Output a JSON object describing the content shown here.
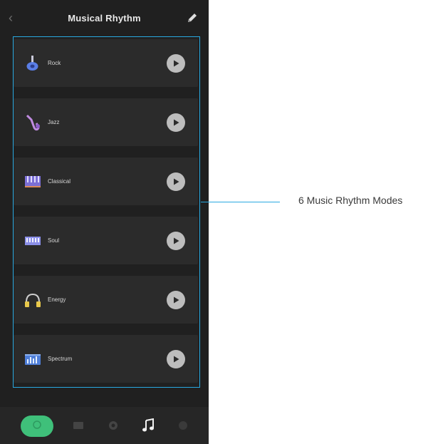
{
  "header": {
    "title": "Musical Rhythm",
    "back_icon": "chevron-left-icon",
    "edit_icon": "pencil-icon"
  },
  "modes": [
    {
      "label": "Rock",
      "icon": "guitar-icon"
    },
    {
      "label": "Jazz",
      "icon": "saxophone-icon"
    },
    {
      "label": "Classical",
      "icon": "piano-icon"
    },
    {
      "label": "Soul",
      "icon": "keyboard-icon"
    },
    {
      "label": "Energy",
      "icon": "headphones-icon"
    },
    {
      "label": "Spectrum",
      "icon": "equalizer-icon"
    }
  ],
  "callout": {
    "text": "6 Music Rhythm Modes",
    "color": "#29a9e1"
  },
  "bottom_nav": {
    "items": [
      "power-icon",
      "scene-icon",
      "settings-icon",
      "music-note-icon",
      "more-icon"
    ],
    "active": "music-note-icon",
    "accent": "#3fc07a"
  },
  "colors": {
    "background": "#202020",
    "card": "#2b2b2b",
    "play_button": "#bdbdbd"
  }
}
